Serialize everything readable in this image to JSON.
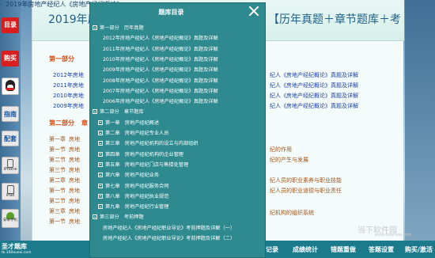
{
  "window": {
    "title_left": "2019年房地产经纪人",
    "title_right": "【历年真题＋章节题库＋考",
    "topline": "2019年房地产经纪人《房地产经纪概论》"
  },
  "sidebar": {
    "catalog": "目录",
    "buy": "购买",
    "guide": "指南",
    "accessory": "配套",
    "iphone": "iPhone",
    "ipad": "iPad",
    "android": "安卓手机"
  },
  "document": {
    "part1_prefix": "第一部分",
    "part1_lines_left": [
      "2012年房地",
      "2011年房地",
      "2010年房地",
      "2009年房地"
    ],
    "part1_lines_right": [
      "纪人《房地产经纪概论》真题及详解",
      "纪人《房地产经纪概论》真题及详解",
      "纪人《房地产经纪概论》真题及详解",
      "纪人《房地产经纪概论》真题及详解"
    ],
    "part2_prefix": "第二部分",
    "part2_suffix": "章",
    "chapter_rows_left": [
      [
        "第一章",
        "房地"
      ],
      [
        "第一节",
        "房地"
      ],
      [
        "第二节",
        "房地"
      ],
      [
        "第三节",
        "房地"
      ],
      [
        "第二章",
        "房地"
      ],
      [
        "第一节",
        "房地"
      ],
      [
        "第二节",
        "房地"
      ],
      [
        "第三章",
        "房地"
      ],
      [
        "第一节",
        "房地"
      ]
    ],
    "chapter_rows_right": [
      "纪的作用",
      "纪的产生与发展",
      "纪人员的职业素养与职业技能",
      "纪人员的职业道德与职业责任",
      "纪机构的组织系统"
    ]
  },
  "modal": {
    "title": "题库目录",
    "items": [
      {
        "level": 0,
        "label": "第一部分　历年真题",
        "toggle": true
      },
      {
        "level": 1,
        "label": "2012年房地产经纪人《房地产经纪概论》真题及详解",
        "toggle": false
      },
      {
        "level": 1,
        "label": "2011年房地产经纪人《房地产经纪概论》真题及详解",
        "toggle": false
      },
      {
        "level": 1,
        "label": "2010年房地产经纪人《房地产经纪概论》真题及详解",
        "toggle": false
      },
      {
        "level": 1,
        "label": "2009年房地产经纪人《房地产经纪概论》真题及详解",
        "toggle": false
      },
      {
        "level": 1,
        "label": "2008年房地产经纪人《房地产经纪概论》真题及详解",
        "toggle": false
      },
      {
        "level": 1,
        "label": "2007年房地产经纪人《房地产经纪概论》真题及详解",
        "toggle": false
      },
      {
        "level": 1,
        "label": "2006年房地产经纪人《房地产经纪概论》真题及详解",
        "toggle": false
      },
      {
        "level": 0,
        "label": "第二部分　章节题库",
        "toggle": true
      },
      {
        "level": 1,
        "label": "第一章　房地产经纪概述",
        "toggle": true
      },
      {
        "level": 1,
        "label": "第二章　房地产经纪专业人员",
        "toggle": true
      },
      {
        "level": 1,
        "label": "第三章　房地产经纪机构的设立与内部组织",
        "toggle": true
      },
      {
        "level": 1,
        "label": "第四章　房地产经纪机构的企业管理",
        "toggle": true
      },
      {
        "level": 1,
        "label": "第五章　房地产经纪门店与售楼处管理",
        "toggle": true
      },
      {
        "level": 1,
        "label": "第六章　房地产经纪业务",
        "toggle": true
      },
      {
        "level": 1,
        "label": "第七章　房地产经纪服务合同",
        "toggle": true
      },
      {
        "level": 1,
        "label": "第八章　房地产经纪执业规范",
        "toggle": true
      },
      {
        "level": 1,
        "label": "第九章　房地产经纪行业管理",
        "toggle": true
      },
      {
        "level": 0,
        "label": "第三部分　考前押题",
        "toggle": true
      },
      {
        "level": 1,
        "label": "房地产经纪人《房地产经纪职业导论》考前押题及详解（一）",
        "toggle": false
      },
      {
        "level": 1,
        "label": "房地产经纪人《房地产经纪职业导论》考前押题及详解（二）",
        "toggle": false
      }
    ]
  },
  "bottom_bar": {
    "brand": "圣才题库",
    "brand_sub": "tk.100xuexi.com",
    "items": [
      "习记录",
      "成绩统计",
      "错题重做",
      "答题设置",
      "购买/激活"
    ]
  },
  "watermark": {
    "text": "当下软件园",
    "sub": "www.downxia.com"
  }
}
